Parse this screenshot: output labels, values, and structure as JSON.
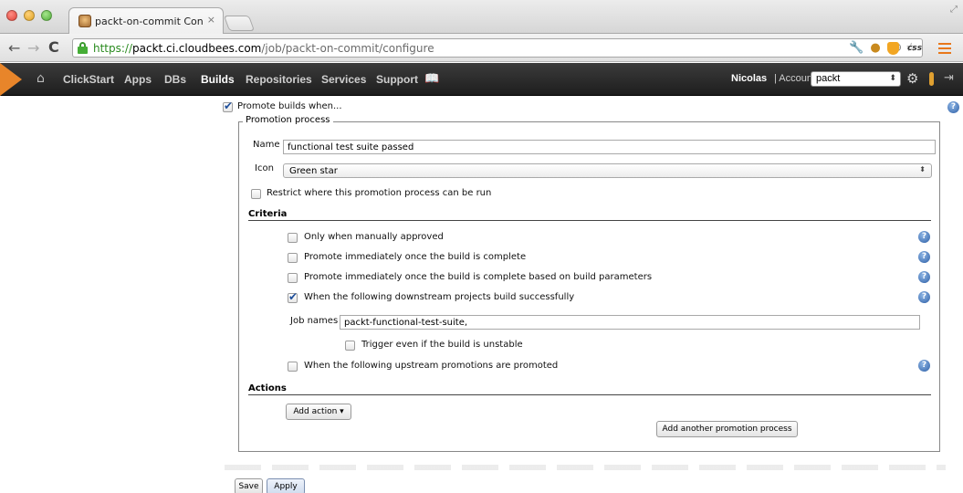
{
  "browser": {
    "tab_title": "packt-on-commit Config",
    "tab_close": "×",
    "url_scheme": "https://",
    "url_host": "packt.ci.cloudbees.com",
    "url_path": "/job/packt-on-commit/configure"
  },
  "cbnav": {
    "links": [
      "ClickStart",
      "Apps",
      "DBs",
      "Builds",
      "Repositories",
      "Services",
      "Support"
    ],
    "active": "Builds",
    "user": "Nicolas",
    "separator": " | Account:",
    "account": "packt",
    "accent": "#e8852a"
  },
  "form": {
    "promote_label": "Promote builds when...",
    "legend": "Promotion process",
    "name_label": "Name",
    "name_value": "functional test suite passed",
    "icon_label": "Icon",
    "icon_value": "Green star",
    "restrict_label": "Restrict where this promotion process can be run",
    "criteria_head": "Criteria",
    "criteria": [
      {
        "label": "Only when manually approved",
        "checked": false
      },
      {
        "label": "Promote immediately once the build is complete",
        "checked": false
      },
      {
        "label": "Promote immediately once the build is complete based on build parameters",
        "checked": false
      },
      {
        "label": "When the following downstream projects build successfully",
        "checked": true
      }
    ],
    "job_names_label": "Job names",
    "job_names_value": "packt-functional-test-suite,",
    "trigger_unstable_label": "Trigger even if the build is unstable",
    "upstream_label": "When the following upstream promotions are promoted",
    "actions_head": "Actions",
    "add_action": "Add action ▾",
    "add_another": "Add another promotion process",
    "save": "Save",
    "apply": "Apply",
    "help": "?"
  }
}
